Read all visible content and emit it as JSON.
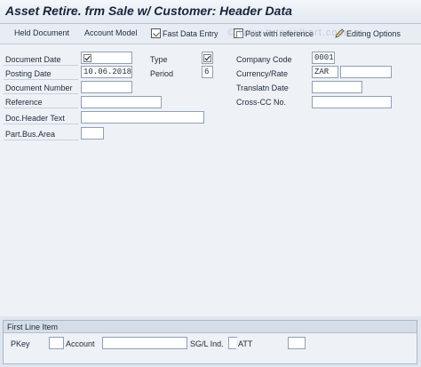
{
  "window": {
    "title": "Asset Retire. frm Sale w/ Customer: Header Data"
  },
  "watermark": "© www.tutorialkart.com",
  "toolbar": {
    "held_document": "Held Document",
    "account_model": "Account Model",
    "fast_data_entry": "Fast Data Entry",
    "post_with_reference": "Post with reference",
    "editing_options": "Editing Options"
  },
  "form": {
    "document_date": {
      "label": "Document Date"
    },
    "type": {
      "label": "Type"
    },
    "company_code": {
      "label": "Company Code",
      "value": "0001"
    },
    "posting_date": {
      "label": "Posting Date",
      "value": "10.06.2018"
    },
    "period": {
      "label": "Period",
      "value": "6"
    },
    "currency_rate": {
      "label": "Currency/Rate",
      "value": "ZAR",
      "rate": ""
    },
    "document_number": {
      "label": "Document Number",
      "value": ""
    },
    "translatn_date": {
      "label": "Translatn Date",
      "value": ""
    },
    "reference": {
      "label": "Reference",
      "value": ""
    },
    "cross_cc_no": {
      "label": "Cross-CC No.",
      "value": ""
    },
    "doc_header_text": {
      "label": "Doc.Header Text",
      "value": ""
    },
    "part_bus_area": {
      "label": "Part.Bus.Area",
      "value": ""
    }
  },
  "first_line_item": {
    "title": "First Line Item",
    "pkey": {
      "label": "PKey",
      "value": ""
    },
    "account": {
      "label": "Account",
      "value": ""
    },
    "sgl_ind": {
      "label": "SG/L Ind.",
      "value": ""
    },
    "att": {
      "label": "ATT",
      "value": ""
    }
  },
  "colors": {
    "background": "#dfe6ef",
    "field_border": "#8fa0b4",
    "title_text": "#16243a"
  }
}
